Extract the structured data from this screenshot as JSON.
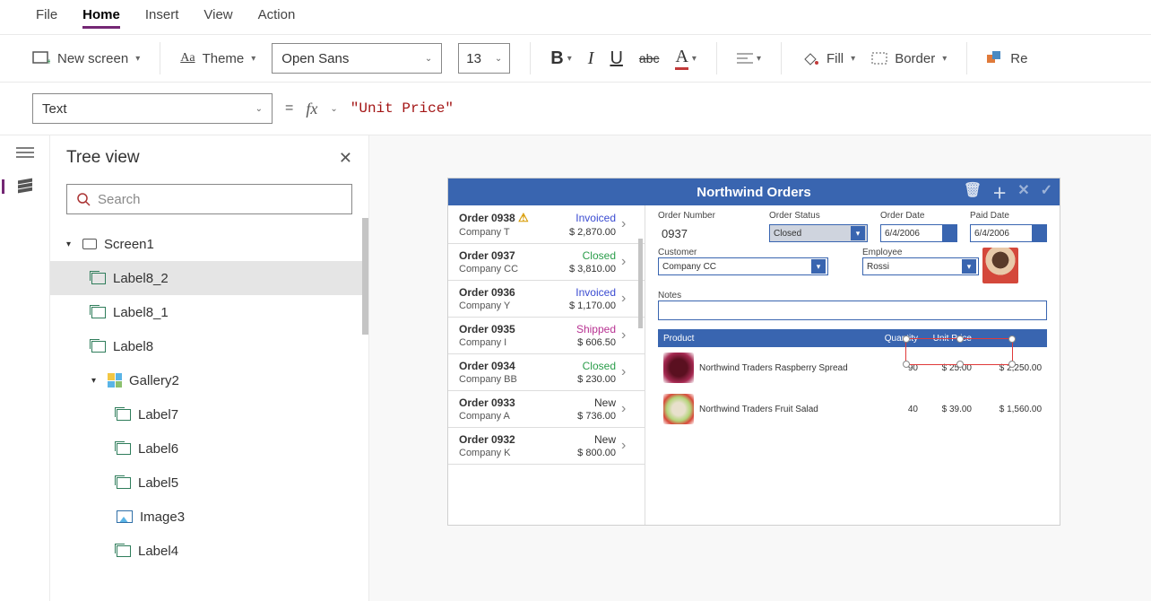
{
  "menu": {
    "file": "File",
    "home": "Home",
    "insert": "Insert",
    "view": "View",
    "action": "Action"
  },
  "ribbon": {
    "new_screen": "New screen",
    "theme": "Theme",
    "font_name": "Open Sans",
    "font_size": "13",
    "fill": "Fill",
    "border": "Border",
    "reorder": "Re"
  },
  "formula": {
    "property": "Text",
    "value": "\"Unit Price\""
  },
  "tree": {
    "title": "Tree view",
    "search_placeholder": "Search",
    "items": {
      "screen1": "Screen1",
      "label8_2": "Label8_2",
      "label8_1": "Label8_1",
      "label8": "Label8",
      "gallery2": "Gallery2",
      "label7": "Label7",
      "label6": "Label6",
      "label5": "Label5",
      "image3": "Image3",
      "label4": "Label4"
    }
  },
  "app": {
    "title": "Northwind Orders",
    "orders": [
      {
        "num": "Order 0938",
        "company": "Company T",
        "status": "Invoiced",
        "amount": "$ 2,870.00",
        "warn": true
      },
      {
        "num": "Order 0937",
        "company": "Company CC",
        "status": "Closed",
        "amount": "$ 3,810.00"
      },
      {
        "num": "Order 0936",
        "company": "Company Y",
        "status": "Invoiced",
        "amount": "$ 1,170.00"
      },
      {
        "num": "Order 0935",
        "company": "Company I",
        "status": "Shipped",
        "amount": "$ 606.50"
      },
      {
        "num": "Order 0934",
        "company": "Company BB",
        "status": "Closed",
        "amount": "$ 230.00"
      },
      {
        "num": "Order 0933",
        "company": "Company A",
        "status": "New",
        "amount": "$ 736.00"
      },
      {
        "num": "Order 0932",
        "company": "Company K",
        "status": "New",
        "amount": "$ 800.00"
      }
    ],
    "detail": {
      "order_number_label": "Order Number",
      "order_number": "0937",
      "order_status_label": "Order Status",
      "order_status": "Closed",
      "order_date_label": "Order Date",
      "order_date": "6/4/2006",
      "paid_date_label": "Paid Date",
      "paid_date": "6/4/2006",
      "customer_label": "Customer",
      "customer": "Company CC",
      "employee_label": "Employee",
      "employee": "Rossi",
      "notes_label": "Notes",
      "headers": {
        "product": "Product",
        "qty": "Quantity",
        "unit": "Unit Price"
      },
      "lines": [
        {
          "name": "Northwind Traders Raspberry Spread",
          "qty": "90",
          "unit": "$ 25.00",
          "ext": "$ 2,250.00"
        },
        {
          "name": "Northwind Traders Fruit Salad",
          "qty": "40",
          "unit": "$ 39.00",
          "ext": "$ 1,560.00"
        }
      ]
    }
  }
}
